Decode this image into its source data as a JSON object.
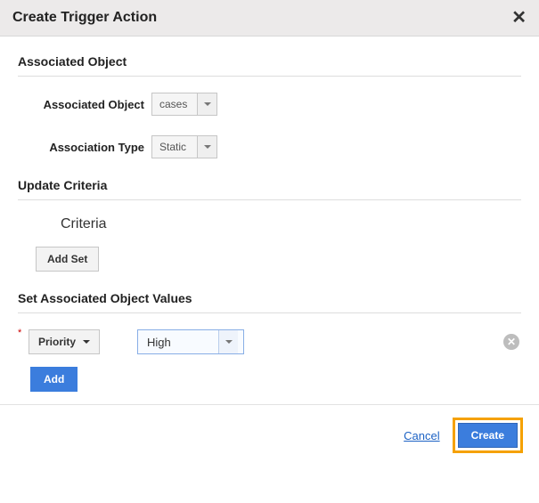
{
  "dialog": {
    "title": "Create Trigger Action"
  },
  "sections": {
    "associated_object": "Associated Object",
    "update_criteria": "Update Criteria",
    "criteria": "Criteria",
    "set_values": "Set Associated Object Values"
  },
  "labels": {
    "associated_object": "Associated Object",
    "association_type": "Association Type"
  },
  "fields": {
    "associated_object": "cases",
    "association_type": "Static",
    "priority_field": "Priority",
    "priority_value": "High"
  },
  "buttons": {
    "add_set": "Add Set",
    "add": "Add",
    "cancel": "Cancel",
    "create": "Create"
  },
  "icons": {
    "close": "✕",
    "remove": "✕"
  }
}
